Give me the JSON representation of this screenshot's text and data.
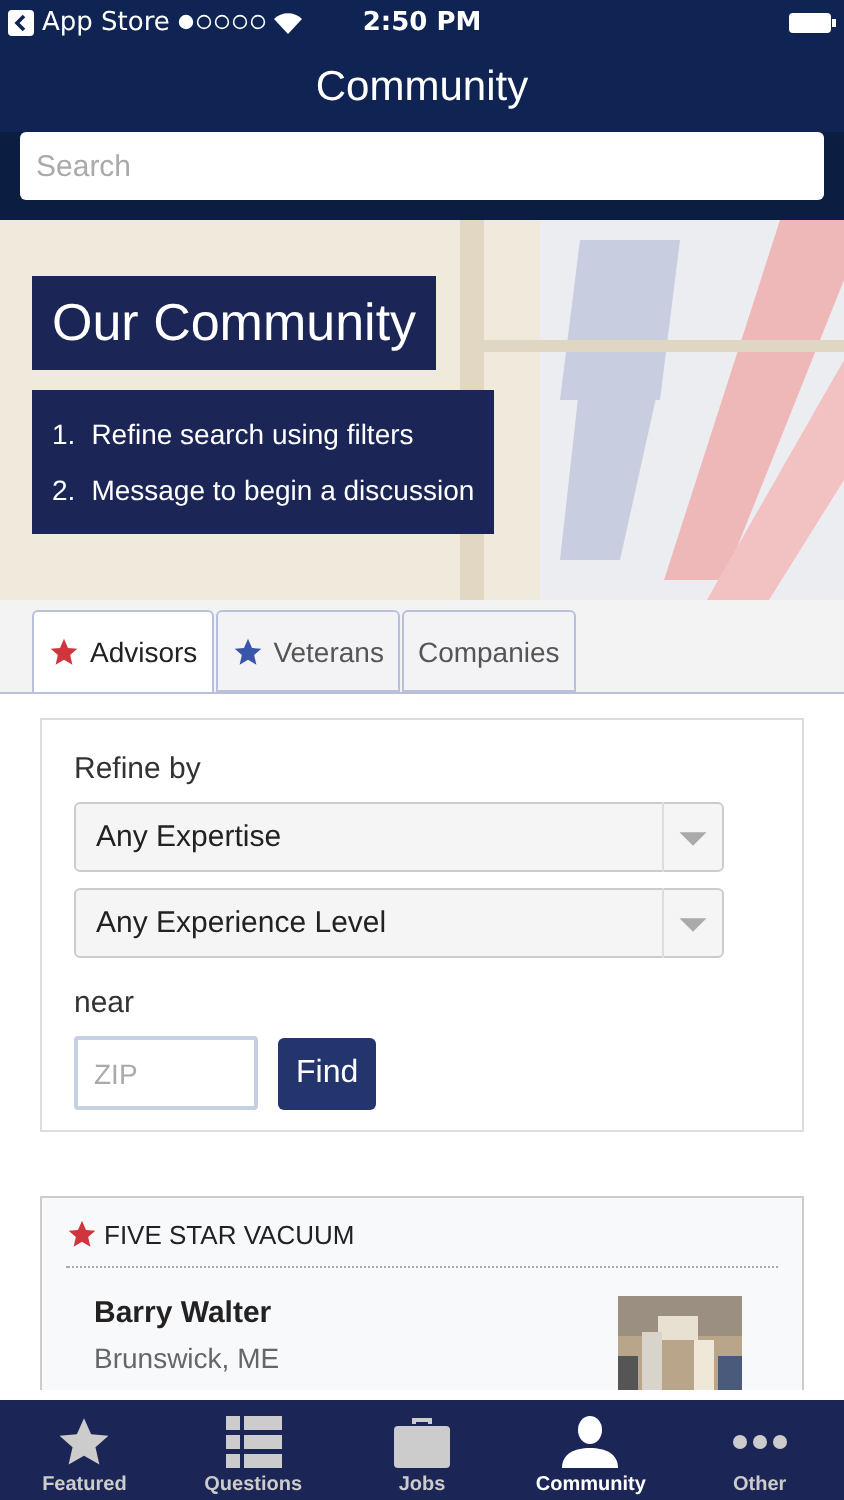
{
  "status_bar": {
    "back_label": "App Store",
    "time": "2:50 PM"
  },
  "nav": {
    "title": "Community"
  },
  "search": {
    "placeholder": "Search"
  },
  "hero": {
    "kind": "picture",
    "title": "Our Community",
    "steps": [
      {
        "number": "1.",
        "text": "Refine search using filters"
      },
      {
        "number": "2.",
        "text": "Message to begin a discussion"
      }
    ]
  },
  "tabs": [
    {
      "label": "Advisors",
      "selected": true,
      "color": "#d0343c"
    },
    {
      "label": "Veterans",
      "selected": false,
      "color": "#3a56a8"
    },
    {
      "label": "Companies",
      "selected": false
    }
  ],
  "filters": {
    "heading": "Refine by",
    "selects": [
      "Any Expertise",
      "Any Experience Level"
    ],
    "near_label": "near",
    "zip_placeholder": "ZIP",
    "find_button": "Find"
  },
  "listing": {
    "company": "FIVE STAR VACUUM",
    "name": "Barry Walter",
    "location": "Brunswick, ME"
  },
  "tab_bar": [
    {
      "label": "Featured",
      "selected": false
    },
    {
      "label": "Questions",
      "selected": false
    },
    {
      "label": "Jobs",
      "selected": false
    },
    {
      "label": "Community",
      "selected": true
    },
    {
      "label": "Other",
      "selected": false
    }
  ]
}
